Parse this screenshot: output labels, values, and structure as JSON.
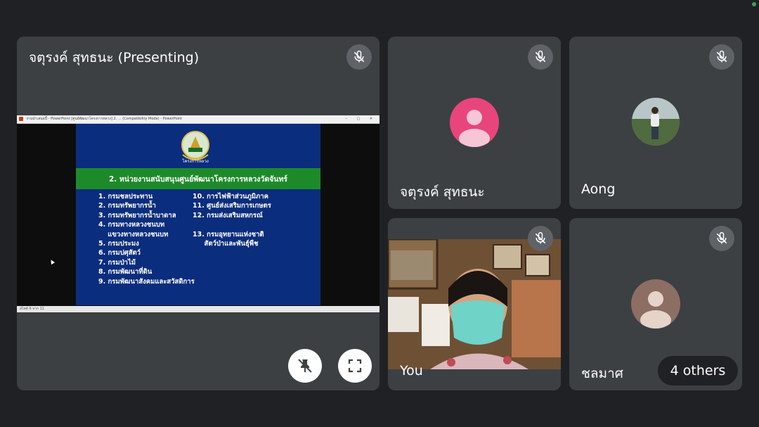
{
  "presenter_tile": {
    "name": "จตุรงค์ สุทธนะ (Presenting)",
    "slide": {
      "window_title": "งานนำเสนอนี้ - PowerPoint   [ศูนย์พัฒนาโครงการหลวง] 2. ... (Compatibility Mode) - PowerPoint",
      "status_text": "สไลด์ 6 จาก 11",
      "logo_caption": "โครงการหลวง",
      "heading": "2. หน่วยงานสนับสนุนศูนย์พัฒนาโครงการหลวงวัดจันทร์",
      "left_items": [
        "1. กรมชลประทาน",
        "2. กรมทรัพยากรน้ำ",
        "3. กรมทรัพยากรน้ำบาดาล",
        "4. กรมทางหลวงชนบท",
        "    แขวงทางหลวงชนบท",
        "5. กรมประมง",
        "6. กรมปศุสัตว์",
        "7. กรมป่าไม้",
        "8. กรมพัฒนาที่ดิน",
        "9. กรมพัฒนาสังคมและสวัสดิการ"
      ],
      "right_items": [
        "10. การไฟฟ้าส่วนภูมิภาค",
        "11. ศูนย์ส่งเสริมการเกษตร",
        "12. กรมส่งเสริมสหกรณ์",
        "",
        "13. กรมอุทยานแห่งชาติ",
        "     สัตว์ป่าและพันธุ์พืช"
      ]
    }
  },
  "participants": [
    {
      "name": "จตุรงค์ สุทธนะ",
      "avatar": "person-icon",
      "avatar_color": "#e8457c"
    },
    {
      "name": "Aong",
      "avatar": "profile-photo"
    },
    {
      "name": "You",
      "avatar": "camera-feed"
    },
    {
      "name": "ชลมาศ",
      "avatar": "person-icon",
      "avatar_color": "#8d6e63"
    }
  ],
  "others_label": "4 others",
  "icons": {
    "mic": "mic-off-icon",
    "pin": "unpin-icon",
    "fullscreen": "fullscreen-icon"
  },
  "colors": {
    "background": "#202124",
    "tile": "#3c4043",
    "slide_blue": "#0b2d7d",
    "slide_green": "#1d8a2a"
  }
}
